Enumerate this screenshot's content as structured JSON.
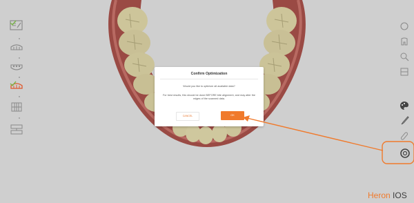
{
  "colors": {
    "viewport_bg": "#cfcfcf",
    "accent": "#f07a2c",
    "check": "#7ab648",
    "icon": "#8a8a8a"
  },
  "left_toolbar": {
    "steps": [
      {
        "icon": "prescription-form-icon",
        "completed": true
      },
      {
        "icon": "upper-jaw-scan-icon",
        "completed": false
      },
      {
        "icon": "lower-jaw-scan-icon",
        "completed": false
      },
      {
        "icon": "upper-jaw-active-icon",
        "completed": true
      },
      {
        "icon": "lower-teeth-icon",
        "completed": false
      },
      {
        "icon": "bite-scan-icon",
        "completed": false
      }
    ]
  },
  "right_toolbar": {
    "tools": [
      {
        "icon": "rotate-icon"
      },
      {
        "icon": "tooth-icon"
      },
      {
        "icon": "zoom-icon"
      },
      {
        "icon": "fit-view-icon"
      },
      {
        "icon": "color-palette-icon"
      },
      {
        "icon": "brush-icon"
      },
      {
        "icon": "trim-icon"
      },
      {
        "icon": "optimize-settings-icon"
      }
    ]
  },
  "dialog": {
    "title": "Confirm Optimization",
    "question": "Would you like to optimize all available data?",
    "note": "For best results, this should be done BEFORE bite alignment, and may alter the edges of the scanned data.",
    "cancel_label": "CANCEL",
    "ok_label": "OK"
  },
  "brand": {
    "part1": "Heron",
    "part2": " IOS"
  }
}
